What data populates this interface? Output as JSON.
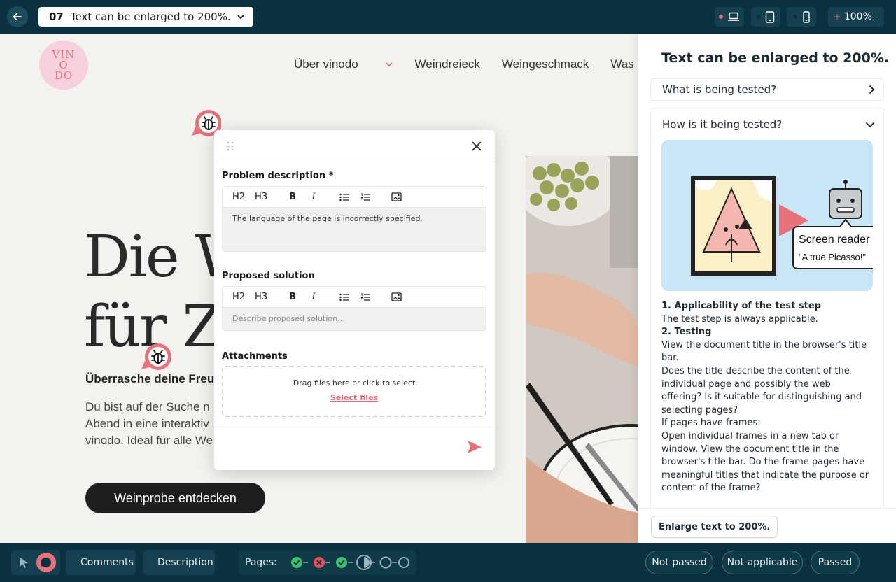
{
  "topbar": {
    "step_number": "07",
    "step_title": "Text can be enlarged to 200%.",
    "zoom": "100%",
    "zoom_minus": "-",
    "zoom_plus": "+"
  },
  "site": {
    "logo": [
      "VIN",
      "O",
      "DO"
    ],
    "nav": [
      "Über vinodo",
      "Weindreieck",
      "Weingeschmack",
      "Was er"
    ],
    "hero_line1": "Die W",
    "hero_line2": "für Zw",
    "subheading": "Überrasche deine Freu",
    "body_lines": [
      "Du bist auf der Suche n",
      "Abend in eine interaktiv",
      "vinodo. Ideal für alle We"
    ],
    "cta": "Weinprobe entdecken"
  },
  "issue": {
    "problem_label": "Problem description *",
    "problem_text": "The language of the page is incorrectly specified.",
    "solution_label": "Proposed solution",
    "solution_placeholder": "Describe proposed solution...",
    "toolbar": {
      "h2": "H2",
      "h3": "H3",
      "bold": "B",
      "italic": "I"
    },
    "attachments_label": "Attachments",
    "dropzone_text": "Drag files here or click to select",
    "select_files": "Select files"
  },
  "panel": {
    "title": "Text can be enlarged to 200%.",
    "accordion_what": "What is being tested?",
    "accordion_how": "How is it being tested?",
    "illustration_caption": "Screen reader",
    "illustration_quote": "\"A true Picasso!\"",
    "description": [
      {
        "text": "1. Applicability of the test step",
        "heading": true
      },
      {
        "text": "The test step is always applicable.",
        "heading": false
      },
      {
        "text": "2. Testing",
        "heading": true
      },
      {
        "text": "View the document title in the browser's title bar.",
        "heading": false
      },
      {
        "text": "Does the title describe the content of the individual page and possibly the web offering? Is it suitable for distinguishing and selecting pages?",
        "heading": false
      },
      {
        "text": "If pages have frames:",
        "heading": false
      },
      {
        "text": "Open individual frames in a new tab or window. View the document title in the browser's title bar. Do the frame pages have meaningful titles that indicate the purpose or content of the frame?",
        "heading": false
      }
    ],
    "enlarge_button": "Enlarge text to 200%."
  },
  "bottombar": {
    "comments": "Comments",
    "description": "Description",
    "pages_label": "Pages:",
    "page_states": [
      "passed",
      "failed",
      "passed",
      "current",
      "open",
      "open"
    ],
    "not_passed": "Not passed",
    "not_applicable": "Not applicable",
    "passed": "Passed"
  },
  "colors": {
    "dark": "#0b3140",
    "accent": "#e8707a",
    "pass": "#3fbf70",
    "fail": "#e8505b",
    "text": "#1c2a33"
  }
}
